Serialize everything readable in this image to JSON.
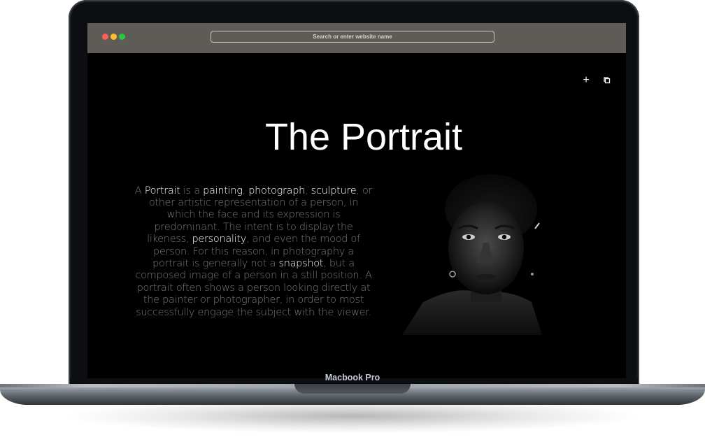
{
  "browser": {
    "url_placeholder": "Search or enter website name",
    "traffic_lights": [
      "#ff5f57",
      "#febc2e",
      "#28c840"
    ]
  },
  "page": {
    "title": "The Portrait",
    "description": {
      "seg1": "A ",
      "link_portrait": "Portrait",
      "seg2": " is a ",
      "link_painting": "painting",
      "seg3": ", ",
      "link_photograph": "photograph",
      "seg4": ", ",
      "link_sculpture": "sculpture",
      "seg5": ", or other artistic representation of a person, in which the face and its expression is predominant. The intent is to display the likeness, ",
      "link_personality": "personality",
      "seg6": ", and even the mood of person. For this reason, in photography a portrait is generally not a ",
      "link_snapshot": "snapshot",
      "seg7": ", but a composed image of a person in a still position. A portrait often shows a person looking directly at the painter or photographer, in order to most successfully engage the subject with the viewer."
    },
    "icons": [
      "plus-icon",
      "copy-icon"
    ]
  },
  "device": {
    "model_label": "Macbook Pro"
  }
}
